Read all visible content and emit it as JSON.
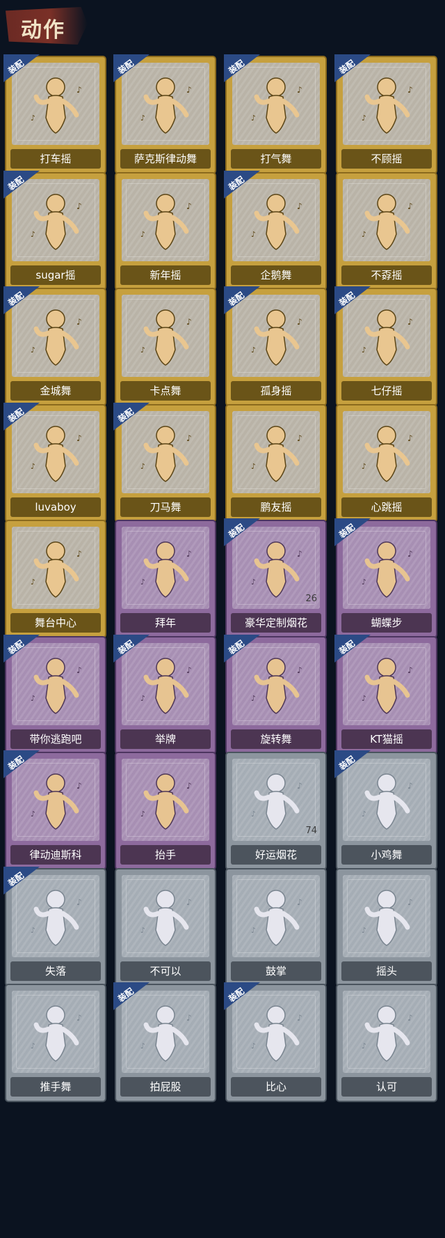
{
  "header": {
    "title": "动作"
  },
  "equip_label": "装配",
  "items": [
    {
      "label": "打车摇",
      "tier": "gold",
      "equipped": true,
      "icon": "dancer-pose-icon"
    },
    {
      "label": "萨克斯律动舞",
      "tier": "gold",
      "equipped": true,
      "icon": "dancer-pose-icon"
    },
    {
      "label": "打气舞",
      "tier": "gold",
      "equipped": true,
      "icon": "dancer-pose-icon"
    },
    {
      "label": "不顾摇",
      "tier": "gold",
      "equipped": true,
      "icon": "dancer-pose-icon"
    },
    {
      "label": "sugar摇",
      "tier": "gold",
      "equipped": true,
      "icon": "dancer-pose-icon"
    },
    {
      "label": "新年摇",
      "tier": "gold",
      "equipped": false,
      "icon": "dancer-pose-icon"
    },
    {
      "label": "企鹅舞",
      "tier": "gold",
      "equipped": true,
      "icon": "dancer-pose-icon"
    },
    {
      "label": "不孬摇",
      "tier": "gold",
      "equipped": false,
      "icon": "dancer-pose-icon"
    },
    {
      "label": "金城舞",
      "tier": "gold",
      "equipped": true,
      "icon": "dancer-pose-icon"
    },
    {
      "label": "卡点舞",
      "tier": "gold",
      "equipped": false,
      "icon": "dancer-pose-icon"
    },
    {
      "label": "孤身摇",
      "tier": "gold",
      "equipped": true,
      "icon": "dancer-pose-icon"
    },
    {
      "label": "七仔摇",
      "tier": "gold",
      "equipped": true,
      "icon": "dancer-pose-icon"
    },
    {
      "label": "luvaboy",
      "tier": "gold",
      "equipped": true,
      "icon": "dancer-pose-icon"
    },
    {
      "label": "刀马舞",
      "tier": "gold",
      "equipped": true,
      "icon": "dancer-pose-icon"
    },
    {
      "label": "鹏友摇",
      "tier": "gold",
      "equipped": false,
      "icon": "dancer-pose-icon"
    },
    {
      "label": "心跳摇",
      "tier": "gold",
      "equipped": false,
      "icon": "dancer-pose-icon"
    },
    {
      "label": "舞台中心",
      "tier": "gold",
      "equipped": false,
      "icon": "dancer-pose-icon"
    },
    {
      "label": "拜年",
      "tier": "purple",
      "equipped": false,
      "icon": "bow-pose-icon"
    },
    {
      "label": "豪华定制烟花",
      "tier": "purple",
      "equipped": true,
      "icon": "fireworks-box-icon",
      "count": "26"
    },
    {
      "label": "蝴蝶步",
      "tier": "purple",
      "equipped": true,
      "icon": "dancer-pose-icon"
    },
    {
      "label": "带你逃跑吧",
      "tier": "purple",
      "equipped": true,
      "icon": "dancer-pose-icon"
    },
    {
      "label": "举牌",
      "tier": "purple",
      "equipped": true,
      "icon": "sign-holding-icon"
    },
    {
      "label": "旋转舞",
      "tier": "purple",
      "equipped": true,
      "icon": "dancer-pose-icon"
    },
    {
      "label": "KT猫摇",
      "tier": "purple",
      "equipped": true,
      "icon": "dancer-pose-icon"
    },
    {
      "label": "律动迪斯科",
      "tier": "purple",
      "equipped": true,
      "icon": "dancer-pose-icon"
    },
    {
      "label": "抬手",
      "tier": "purple",
      "equipped": false,
      "icon": "raise-hand-icon"
    },
    {
      "label": "好运烟花",
      "tier": "silver",
      "equipped": false,
      "icon": "firework-can-icon",
      "count": "74"
    },
    {
      "label": "小鸡舞",
      "tier": "silver",
      "equipped": true,
      "icon": "chicken-dance-icon"
    },
    {
      "label": "失落",
      "tier": "silver",
      "equipped": true,
      "icon": "kneeling-pose-icon"
    },
    {
      "label": "不可以",
      "tier": "silver",
      "equipped": false,
      "icon": "finger-wag-icon"
    },
    {
      "label": "鼓掌",
      "tier": "silver",
      "equipped": false,
      "icon": "clapping-hands-icon"
    },
    {
      "label": "摇头",
      "tier": "silver",
      "equipped": false,
      "icon": "head-shake-icon"
    },
    {
      "label": "推手舞",
      "tier": "silver",
      "equipped": false,
      "icon": "push-hand-dance-icon"
    },
    {
      "label": "拍屁股",
      "tier": "silver",
      "equipped": true,
      "icon": "butt-slap-icon"
    },
    {
      "label": "比心",
      "tier": "silver",
      "equipped": true,
      "icon": "finger-heart-icon"
    },
    {
      "label": "认可",
      "tier": "silver",
      "equipped": false,
      "icon": "thumbs-up-icon"
    }
  ]
}
